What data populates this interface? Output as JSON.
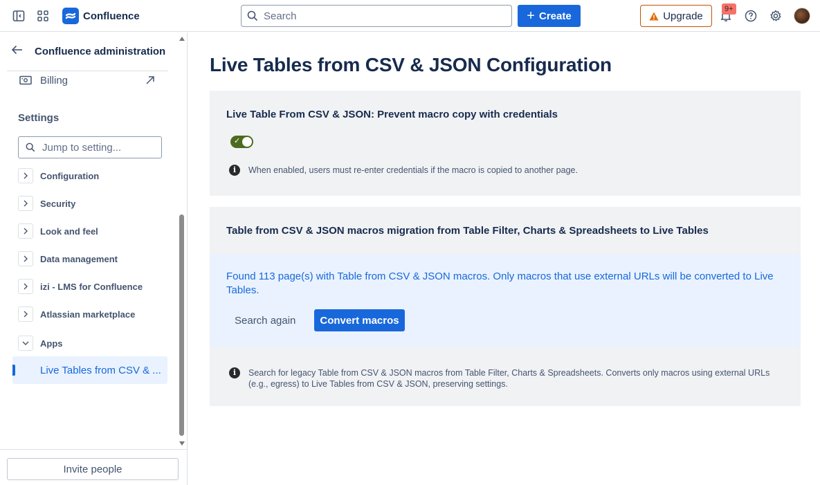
{
  "topbar": {
    "logo_text": "Confluence",
    "search_placeholder": "Search",
    "create_label": "Create",
    "upgrade_label": "Upgrade",
    "notification_count": "9+"
  },
  "sidebar": {
    "header_title": "Confluence administration",
    "billing_label": "Billing",
    "settings_title": "Settings",
    "jump_placeholder": "Jump to setting...",
    "items": [
      {
        "label": "Configuration"
      },
      {
        "label": "Security"
      },
      {
        "label": "Look and feel"
      },
      {
        "label": "Data management"
      },
      {
        "label": "izi - LMS for Confluence"
      },
      {
        "label": "Atlassian marketplace"
      },
      {
        "label": "Apps"
      }
    ],
    "active_item": "Live Tables from CSV & ...",
    "invite_label": "Invite people"
  },
  "main": {
    "title": "Live Tables from CSV & JSON Configuration",
    "panel1": {
      "heading": "Live Table From CSV & JSON: Prevent macro copy with credentials",
      "toggle_on": true,
      "info": "When enabled, users must re-enter credentials if the macro is copied to another page."
    },
    "panel2": {
      "heading": "Table from CSV & JSON macros migration from Table Filter, Charts & Spreadsheets to Live Tables",
      "found_text": "Found 113 page(s) with Table from CSV & JSON macros. Only macros that use external URLs will be converted to Live Tables.",
      "search_again_label": "Search again",
      "convert_label": "Convert macros",
      "info": "Search for legacy Table from CSV & JSON macros from Table Filter, Charts & Spreadsheets. Converts only macros using external URLs (e.g., egress) to Live Tables from CSV & JSON, preserving settings."
    }
  },
  "colors": {
    "brand": "#1868db",
    "toggle_on": "#4c6b1f",
    "upgrade_border": "#c25100",
    "badge": "#f87168"
  }
}
